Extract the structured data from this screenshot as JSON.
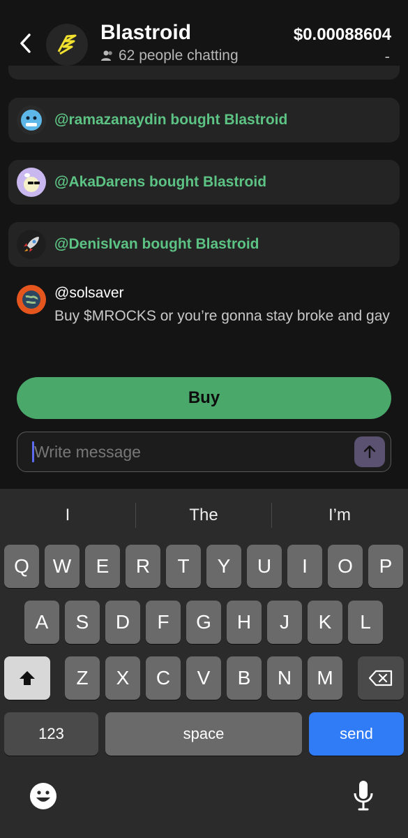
{
  "header": {
    "title": "Blastroid",
    "people": "62 people chatting",
    "price": "$0.00088604",
    "price_change": "-"
  },
  "events": [
    {
      "text": "@ramazanaydin bought Blastroid",
      "avatar": "ice-face-icon"
    },
    {
      "text": "@AkaDarens bought Blastroid",
      "avatar": "sunglasses-avatar-icon"
    },
    {
      "text": "@DenisIvan bought Blastroid",
      "avatar": "rocket-icon"
    }
  ],
  "message": {
    "username": "@solsaver",
    "text": "Buy $MROCKS or you’re gonna stay broke and gay",
    "avatar": "globe-avatar-icon"
  },
  "buy_label": "Buy",
  "input": {
    "placeholder": "Write message"
  },
  "keyboard": {
    "suggestions": [
      "I",
      "The",
      "I’m"
    ],
    "row1": [
      "Q",
      "W",
      "E",
      "R",
      "T",
      "Y",
      "U",
      "I",
      "O",
      "P"
    ],
    "row2": [
      "A",
      "S",
      "D",
      "F",
      "G",
      "H",
      "J",
      "K",
      "L"
    ],
    "row3": [
      "Z",
      "X",
      "C",
      "V",
      "B",
      "N",
      "M"
    ],
    "numbers": "123",
    "space": "space",
    "send": "send"
  },
  "colors": {
    "accent_green": "#4aa86b",
    "event_text": "#5dc384",
    "send_key": "#2f7cf6"
  }
}
